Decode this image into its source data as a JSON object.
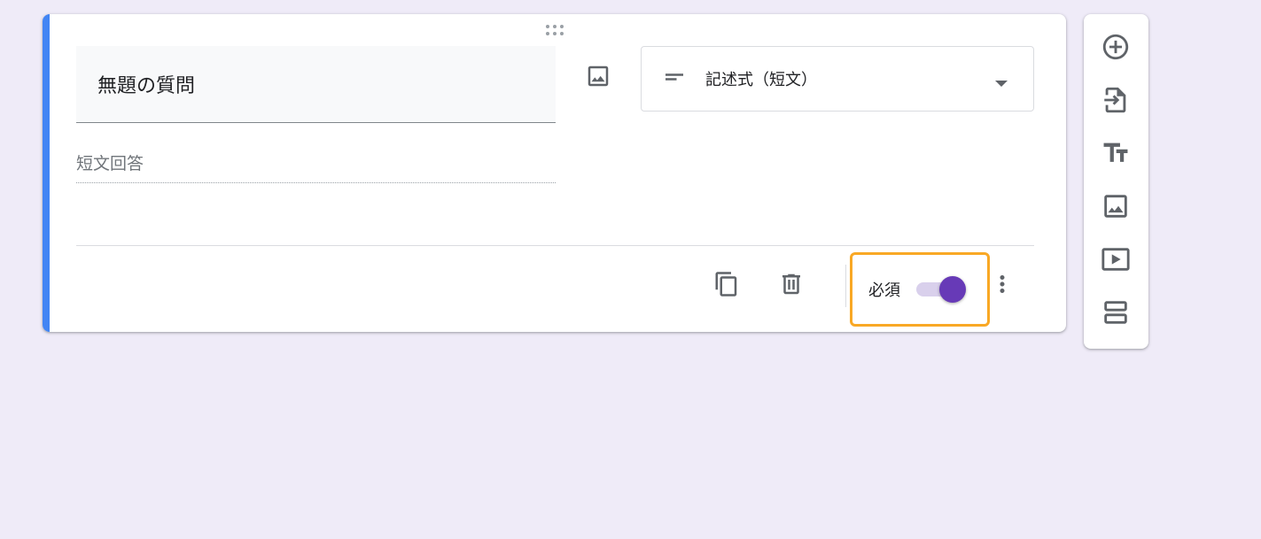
{
  "question": {
    "title": "無題の質問",
    "answer_placeholder": "短文回答"
  },
  "type_select": {
    "selected": "記述式（短文）",
    "icon": "short-text-icon"
  },
  "footer": {
    "required_label": "必須",
    "required_on": true
  },
  "icons": {
    "drag": "drag-handle-icon",
    "add_image": "image-icon",
    "copy": "copy-icon",
    "delete": "trash-icon",
    "more": "more-vert-icon",
    "dropdown": "arrow-drop-down-icon"
  },
  "side_toolbar": {
    "items": [
      {
        "icon": "add-circle-icon"
      },
      {
        "icon": "import-questions-icon"
      },
      {
        "icon": "title-text-icon"
      },
      {
        "icon": "image-icon"
      },
      {
        "icon": "video-icon"
      },
      {
        "icon": "section-icon"
      }
    ]
  },
  "colors": {
    "background": "#efebf8",
    "accent_bar": "#4285f4",
    "toggle_on": "#673ab7",
    "highlight": "#f9a825",
    "icon": "#5f6368"
  }
}
